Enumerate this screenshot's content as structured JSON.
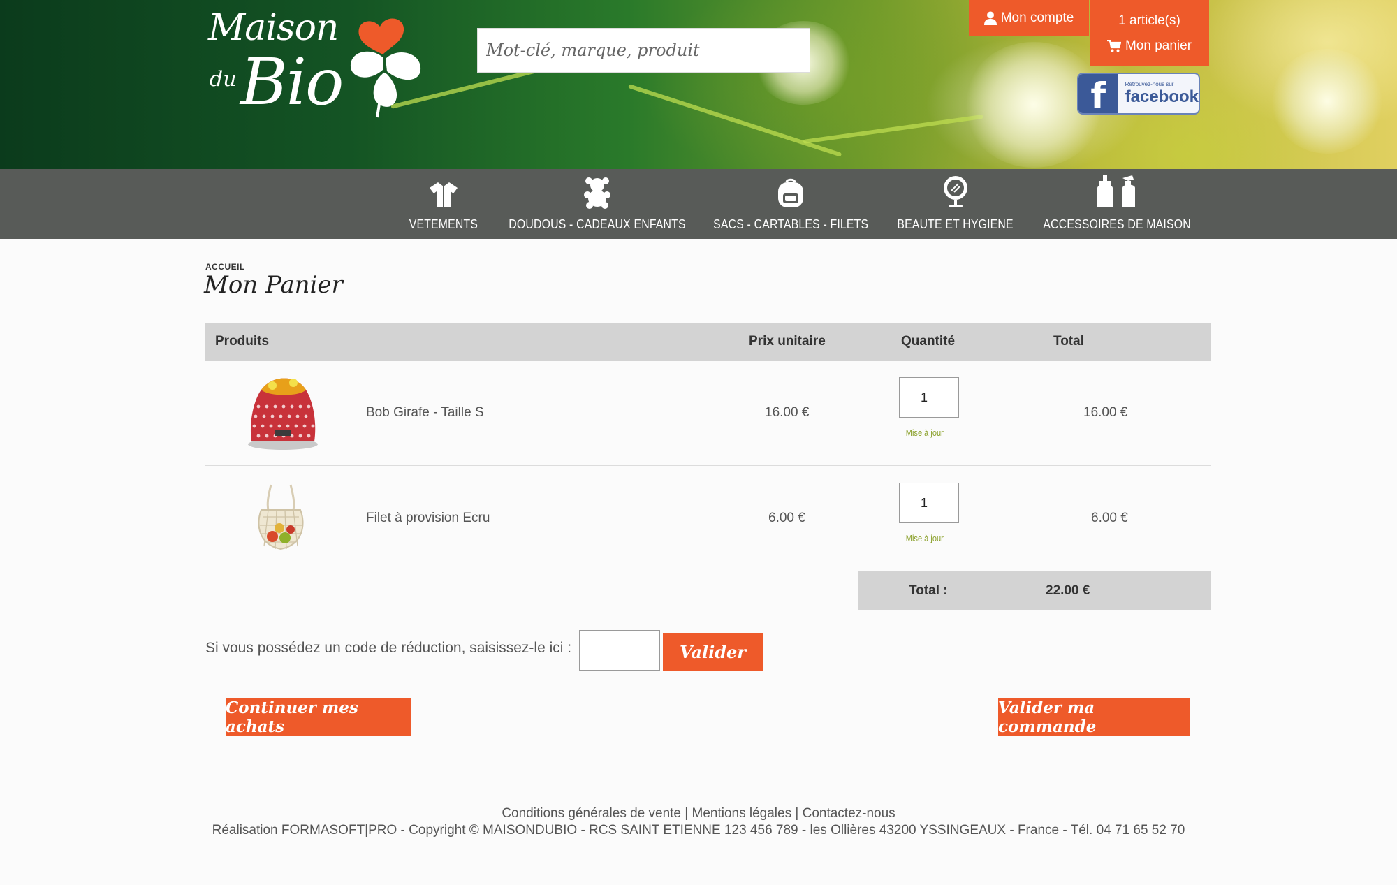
{
  "header": {
    "logo": {
      "line1": "Maison",
      "line2": "du",
      "line3": "Bio"
    },
    "search": {
      "placeholder": "Mot-clé, marque, produit"
    },
    "account_label": "Mon compte",
    "cart": {
      "count_label": "1 article(s)",
      "label": "Mon panier"
    },
    "facebook": {
      "small": "Retrouvez-nous sur",
      "big": "facebook"
    }
  },
  "nav": [
    {
      "label": "VETEMENTS",
      "icon": "shirt-icon"
    },
    {
      "label": "DOUDOUS - CADEAUX ENFANTS",
      "icon": "teddy-bear-icon"
    },
    {
      "label": "SACS - CARTABLES - FILETS",
      "icon": "backpack-icon"
    },
    {
      "label": "BEAUTE ET HYGIENE",
      "icon": "mirror-icon"
    },
    {
      "label": "ACCESSOIRES DE MAISON",
      "icon": "spray-bottles-icon"
    }
  ],
  "breadcrumb": "ACCUEIL",
  "page_title": "Mon Panier",
  "table": {
    "headers": {
      "products": "Produits",
      "unit_price": "Prix unitaire",
      "quantity": "Quantité",
      "total": "Total"
    },
    "rows": [
      {
        "name": "Bob Girafe - Taille S",
        "unit_price": "16.00 €",
        "quantity": "1",
        "update": "Mise à jour",
        "total": "16.00 €"
      },
      {
        "name": "Filet à provision Ecru",
        "unit_price": "6.00 €",
        "quantity": "1",
        "update": "Mise à jour",
        "total": "6.00 €"
      }
    ],
    "total_label": "Total :",
    "total_value": "22.00 €"
  },
  "promo": {
    "label": "Si vous possédez un code de réduction, saisissez-le ici :",
    "button": "Valider"
  },
  "actions": {
    "continue": "Continuer mes achats",
    "checkout": "Valider ma commande"
  },
  "footer": {
    "links": [
      "Conditions générales de vente",
      "Mentions légales",
      "Contactez-nous"
    ],
    "separator": "|",
    "copyright": "Réalisation FORMASOFT|PRO - Copyright © MAISONDUBIO - RCS SAINT ETIENNE 123 456 789 - les Ollières 43200 YSSINGEAUX - France - Tél. 04 71 65 52 70"
  },
  "colors": {
    "accent": "#ee5a2a",
    "nav_bg": "#585b58",
    "table_head_bg": "#d3d3d3",
    "update_link": "#8aa02a"
  }
}
